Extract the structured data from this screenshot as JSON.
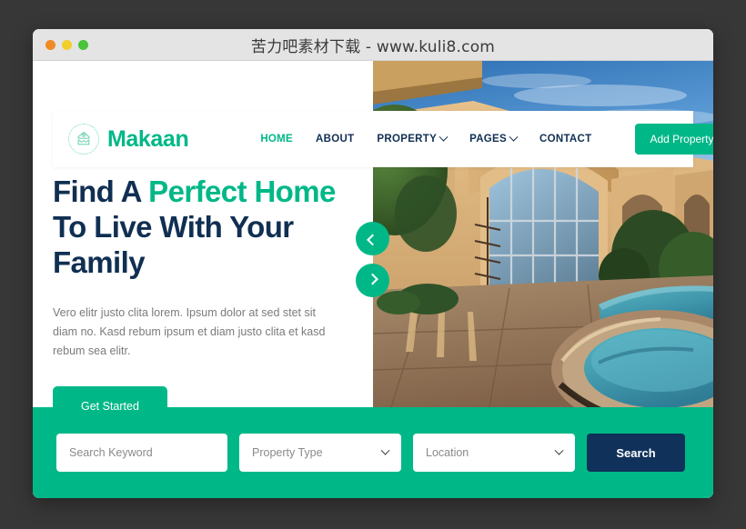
{
  "window": {
    "title": "苦力吧素材下载 - www.kuli8.com",
    "dots": [
      "close",
      "minimize",
      "maximize"
    ]
  },
  "brand": {
    "name": "Makaan",
    "icon": "house-handshake-logo-icon",
    "color": "#00b887"
  },
  "nav": {
    "items": [
      {
        "label": "HOME",
        "active": true,
        "has_dropdown": false
      },
      {
        "label": "ABOUT",
        "active": false,
        "has_dropdown": false
      },
      {
        "label": "PROPERTY",
        "active": false,
        "has_dropdown": true
      },
      {
        "label": "PAGES",
        "active": false,
        "has_dropdown": true
      },
      {
        "label": "CONTACT",
        "active": false,
        "has_dropdown": false
      }
    ],
    "cta_label": "Add Property"
  },
  "hero": {
    "title_part1": "Find A ",
    "title_highlight1": "Perfect",
    "title_part2": " ",
    "title_highlight2": "Home",
    "title_part3": " To Live With Your Family",
    "description": "Vero elitr justo clita lorem. Ipsum dolor at sed stet sit diam no. Kasd rebum ipsum et diam justo clita et kasd rebum sea elitr.",
    "button_label": "Get Started",
    "image_alt": "Mediterranean style house with swimming pool and spa at dusk"
  },
  "carousel": {
    "prev_icon": "chevron-left-icon",
    "next_icon": "chevron-right-icon"
  },
  "search": {
    "keyword_placeholder": "Search Keyword",
    "property_type_label": "Property Type",
    "location_label": "Location",
    "button_label": "Search"
  },
  "colors": {
    "accent_green": "#00b887",
    "navy": "#10315a",
    "band": "#00b887",
    "page_bg": "#373737"
  }
}
